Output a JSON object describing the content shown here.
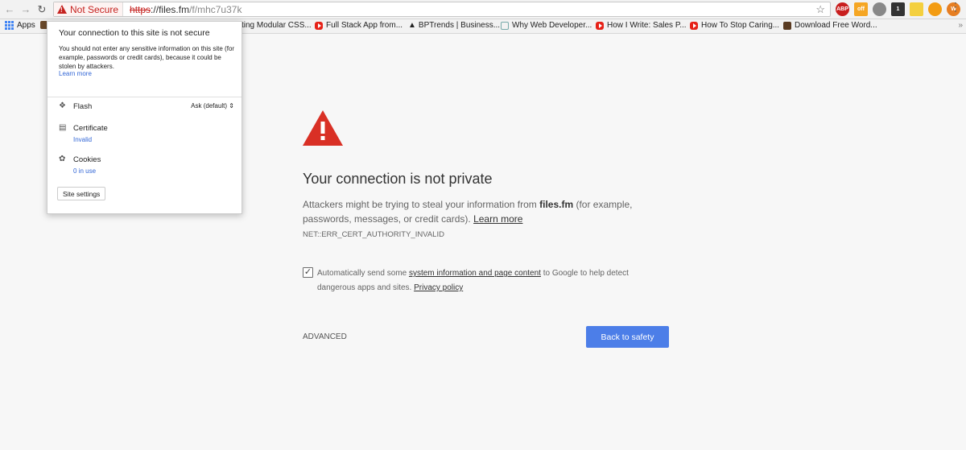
{
  "omnibox": {
    "security_label": "Not Secure",
    "url_scheme": "https",
    "url_rest": "://",
    "url_host": "files.fm",
    "url_path": "/f/mhc7u37k"
  },
  "extensions": [
    "ABP",
    "off",
    "",
    "1",
    "",
    "",
    "W"
  ],
  "bookmarks": {
    "apps_label": "Apps",
    "items": [
      "ting Modular CSS...",
      "Full Stack App from...",
      "BPTrends | Business...",
      "Why Web Developer...",
      "How I Write: Sales P...",
      "How To Stop Caring...",
      "Download Free Word..."
    ],
    "overflow": "»"
  },
  "popup": {
    "title": "Your connection to this site is not secure",
    "description": "You should not enter any sensitive information on this site (for example, passwords or credit cards), because it could be stolen by attackers.",
    "learn_more": "Learn more",
    "flash_label": "Flash",
    "flash_value": "Ask (default)",
    "certificate_label": "Certificate",
    "certificate_status": "Invalid",
    "cookies_label": "Cookies",
    "cookies_status": "0 in use",
    "site_settings": "Site settings"
  },
  "interstitial": {
    "headline": "Your connection is not private",
    "body_start": "Attackers might be trying to steal your information from ",
    "body_host": "files.fm",
    "body_end": " (for example, passwords, messages, or credit cards). ",
    "body_link": "Learn more",
    "error_code": "NET::ERR_CERT_AUTHORITY_INVALID",
    "checkbox_checked": true,
    "opt_start": "Automatically send some ",
    "opt_link": "system information and page content",
    "opt_mid": " to Google to help detect dangerous apps and sites. ",
    "opt_link2": "Privacy policy",
    "advanced": "ADVANCED",
    "back_button": "Back to safety"
  },
  "colors": {
    "warning_red": "#c5221f",
    "icon_red": "#d93025",
    "button_blue": "#4c7ee8",
    "link_blue": "#3367d6"
  }
}
